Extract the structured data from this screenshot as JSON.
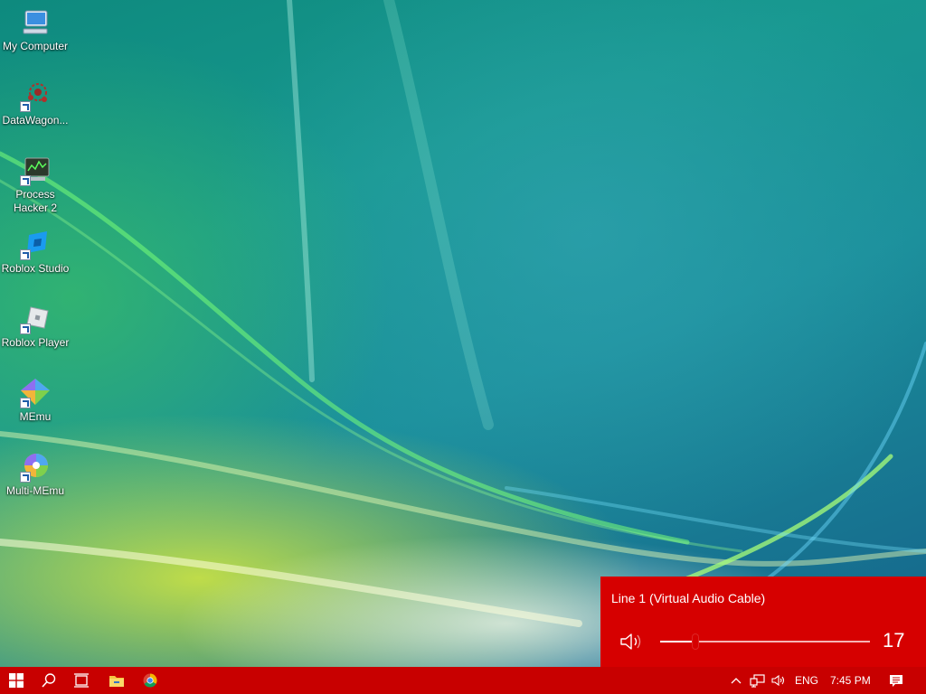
{
  "desktop": {
    "icons": [
      {
        "label": "My Computer",
        "icon": "computer-icon"
      },
      {
        "label": "DataWagon...",
        "icon": "datawagon-icon"
      },
      {
        "label": "Process\nHacker 2",
        "icon": "process-hacker-icon"
      },
      {
        "label": "Roblox Studio",
        "icon": "roblox-studio-icon"
      },
      {
        "label": "Roblox Player",
        "icon": "roblox-player-icon"
      },
      {
        "label": "MEmu",
        "icon": "memu-icon"
      },
      {
        "label": "Multi-MEmu",
        "icon": "multi-memu-icon"
      }
    ]
  },
  "volume_flyout": {
    "device_name": "Line 1 (Virtual Audio Cable)",
    "volume": 17,
    "volume_display": "17",
    "icon": "speaker-icon"
  },
  "taskbar": {
    "buttons": [
      {
        "name": "start-button",
        "icon": "windows-logo-icon"
      },
      {
        "name": "search-button",
        "icon": "search-icon"
      },
      {
        "name": "task-view-button",
        "icon": "task-view-icon"
      },
      {
        "name": "file-explorer-button",
        "icon": "folder-icon"
      },
      {
        "name": "chrome-button",
        "icon": "chrome-icon"
      }
    ],
    "tray": {
      "language": "ENG",
      "time": "7:45 PM",
      "icons": [
        "chevron-up-icon",
        "network-icon",
        "volume-icon",
        "action-center-icon"
      ]
    }
  },
  "colors": {
    "accent": "#d60000",
    "taskbar": "#c80000"
  }
}
